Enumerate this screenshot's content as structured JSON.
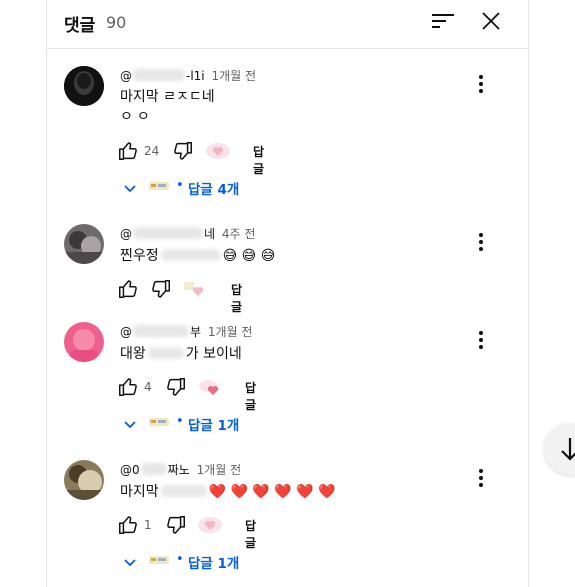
{
  "header": {
    "title": "댓글",
    "count": "90"
  },
  "comments": [
    {
      "author_suffix": "-l1i",
      "time": "1개월 전",
      "text_line1": "마지막 ㄹㅈㄷ네",
      "text_line2": "ㅇㅇ",
      "likes": "24",
      "reply_label": "답글",
      "replies_label": "답글 4개"
    },
    {
      "author_suffix": "네",
      "time": "4주 전",
      "text_before": "찐우정",
      "emojis": "😅 😅 😅",
      "likes": "",
      "reply_label": "답글"
    },
    {
      "author_suffix": "부",
      "time": "1개월 전",
      "text_before": "대왕",
      "text_after": "가 보이네",
      "likes": "4",
      "reply_label": "답글",
      "replies_label": "답글 1개"
    },
    {
      "author_prefix": "@0",
      "author_suffix": "짜노",
      "time": "1개월 전",
      "text_before": "마지막",
      "emojis": "❤️ ❤️ ❤️ ❤️ ❤️ ❤️",
      "likes": "1",
      "reply_label": "답글",
      "replies_label": "답글 1개"
    }
  ],
  "icons": {
    "sort": "sort-icon",
    "close": "close-icon",
    "kebab": "more-vert-icon",
    "like": "thumb-up-icon",
    "dislike": "thumb-down-icon",
    "expand": "chevron-down-icon",
    "scroll": "arrow-down-icon"
  },
  "colors": {
    "link_blue": "#065fd4",
    "muted": "#606060"
  }
}
